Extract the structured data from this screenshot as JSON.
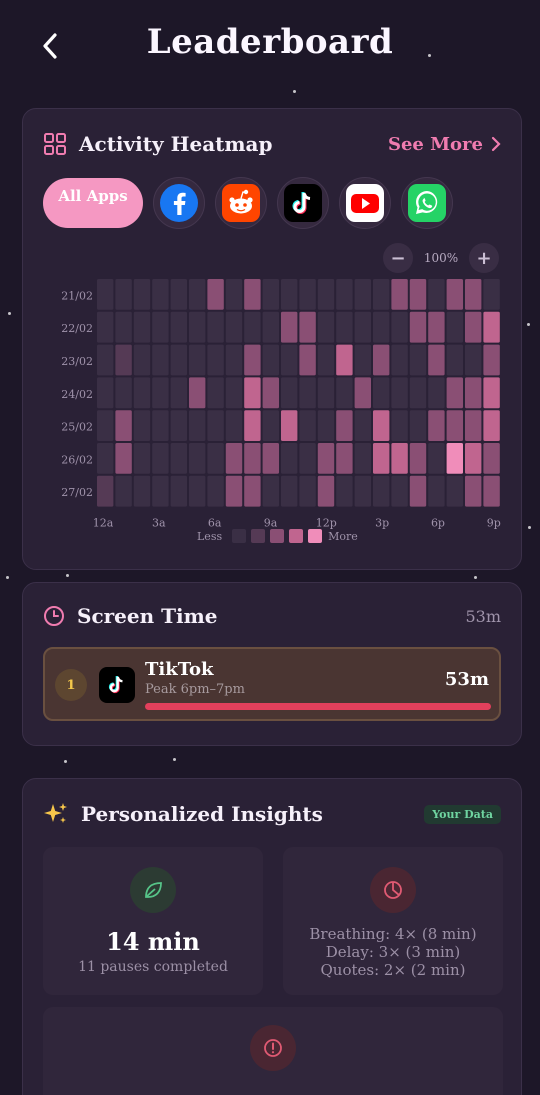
{
  "header": {
    "title": "Leaderboard"
  },
  "heatmap": {
    "title": "Activity Heatmap",
    "see_more": "See More",
    "apps": [
      {
        "label": "All Apps",
        "icon": "all-apps",
        "selected": true
      },
      {
        "icon": "facebook-icon",
        "color": "#1877f2"
      },
      {
        "icon": "reddit-icon",
        "color": "#ff4500"
      },
      {
        "icon": "tiktok-icon",
        "color": "#000000"
      },
      {
        "icon": "youtube-icon",
        "color": "#ff0000"
      },
      {
        "icon": "whatsapp-icon",
        "color": "#25d366"
      }
    ],
    "zoom": {
      "minus": "−",
      "value": "100%",
      "plus": "+"
    },
    "legend": {
      "less": "Less",
      "more": "More"
    }
  },
  "chart_data": {
    "type": "heatmap",
    "rows": [
      "21/02",
      "22/02",
      "23/02",
      "24/02",
      "25/02",
      "26/02",
      "27/02"
    ],
    "x_tick_labels": [
      "12a",
      "3a",
      "6a",
      "9a",
      "12p",
      "3p",
      "6p",
      "9p"
    ],
    "columns": 22,
    "values": [
      [
        0,
        0,
        0,
        0,
        0,
        0,
        2,
        0,
        2,
        0,
        0,
        0,
        0,
        0,
        0,
        0,
        2,
        2,
        0,
        2,
        2,
        0
      ],
      [
        0,
        0,
        0,
        0,
        0,
        0,
        0,
        0,
        0,
        0,
        2,
        2,
        0,
        0,
        0,
        0,
        0,
        2,
        2,
        0,
        2,
        3
      ],
      [
        0,
        1,
        0,
        0,
        0,
        0,
        0,
        0,
        2,
        0,
        0,
        2,
        0,
        3,
        0,
        2,
        0,
        0,
        2,
        0,
        0,
        2
      ],
      [
        0,
        0,
        0,
        0,
        0,
        2,
        0,
        0,
        3,
        2,
        0,
        0,
        0,
        0,
        2,
        0,
        0,
        0,
        0,
        2,
        2,
        3
      ],
      [
        0,
        2,
        0,
        0,
        0,
        0,
        0,
        0,
        3,
        0,
        3,
        0,
        0,
        2,
        0,
        3,
        0,
        0,
        2,
        2,
        2,
        3
      ],
      [
        0,
        2,
        0,
        0,
        0,
        0,
        0,
        2,
        2,
        2,
        0,
        0,
        2,
        2,
        0,
        3,
        3,
        2,
        0,
        4,
        3,
        2
      ],
      [
        1,
        0,
        0,
        0,
        0,
        0,
        0,
        2,
        2,
        0,
        0,
        0,
        2,
        0,
        0,
        0,
        0,
        2,
        0,
        0,
        2,
        2
      ]
    ],
    "legend_levels": 5
  },
  "colors": {
    "levels": [
      "#3a2f45",
      "#553a55",
      "#8a4f74",
      "#c0658f",
      "#f08dba"
    ]
  },
  "screen_time": {
    "title": "Screen Time",
    "total": "53m",
    "entries": [
      {
        "rank": "1",
        "app": "TikTok",
        "peak": "Peak 6pm–7pm",
        "time": "53m",
        "progress": 1.0
      }
    ]
  },
  "insights": {
    "title": "Personalized Insights",
    "badge": "Your Data",
    "pause_time": "14 min",
    "pause_count": "11 pauses completed",
    "breakdown": [
      "Breathing: 4× (8 min)",
      "Delay: 3× (3 min)",
      "Quotes: 2× (2 min)"
    ]
  }
}
